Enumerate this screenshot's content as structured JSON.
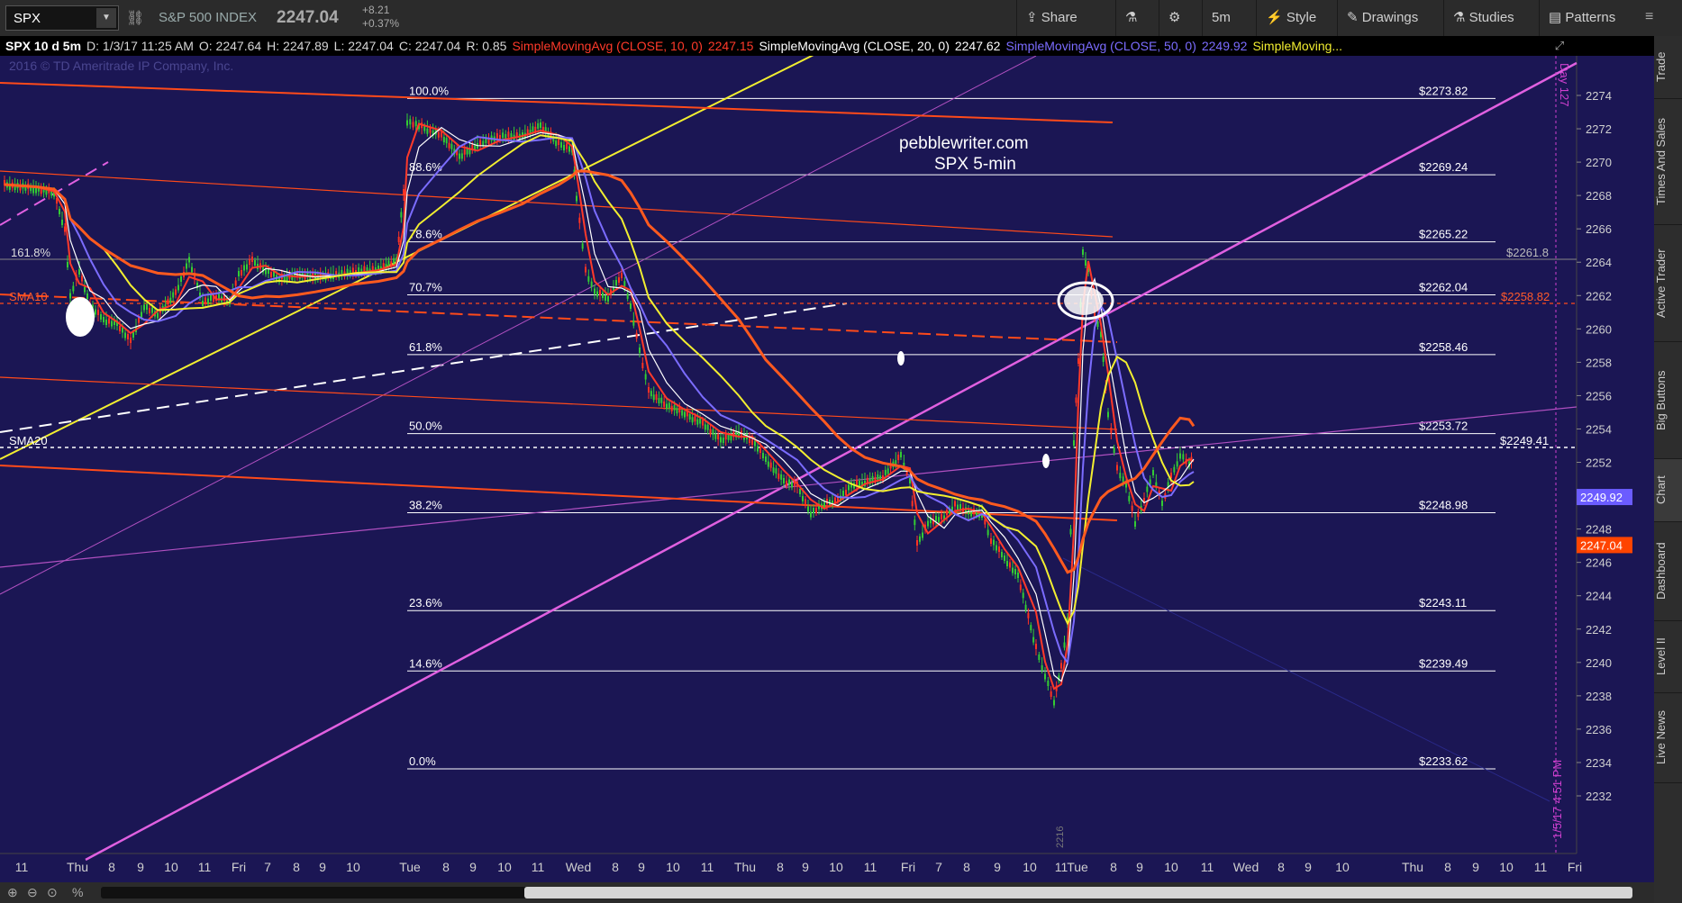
{
  "toolbar": {
    "symbol": "SPX",
    "index_name": "S&P 500 INDEX",
    "price": "2247.04",
    "change": "+8.21",
    "change_pct": "+0.37%",
    "share": "Share",
    "timeframe": "5m",
    "style": "Style",
    "drawings": "Drawings",
    "studies": "Studies",
    "patterns": "Patterns"
  },
  "header": {
    "title": "SPX 10 d 5m",
    "date": "D: 1/3/17 11:25 AM",
    "open": "O: 2247.64",
    "high": "H: 2247.89",
    "low": "L: 2247.04",
    "close": "C: 2247.04",
    "range": "R: 0.85",
    "sma10_label": "SimpleMovingAvg (CLOSE, 10, 0)",
    "sma10_val": "2247.15",
    "sma20_label": "SimpleMovingAvg (CLOSE, 20, 0)",
    "sma20_val": "2247.62",
    "sma50_label": "SimpleMovingAvg (CLOSE, 50, 0)",
    "sma50_val": "2249.92",
    "sma_more": "SimpleMoving..."
  },
  "watermark": "2016 © TD Ameritrade IP Company, Inc.",
  "annotation": {
    "line1": "pebblewriter.com",
    "line2": "SPX 5-min"
  },
  "right_tabs": [
    "Trade",
    "Times And Sales",
    "Active Trader",
    "Big Buttons",
    "Chart",
    "Dashboard",
    "Level II",
    "Live News"
  ],
  "chart_data": {
    "type": "candlestick",
    "y_axis": {
      "min": 2232,
      "max": 2274,
      "ticks": [
        2274,
        2272,
        2270,
        2268,
        2266,
        2264,
        2262,
        2260,
        2258,
        2256,
        2254,
        2252,
        2250,
        2248,
        2246,
        2244,
        2242,
        2240,
        2238,
        2236,
        2234,
        2232
      ]
    },
    "x_ticks": [
      "11",
      "Thu",
      "8",
      "9",
      "10",
      "11",
      "Fri",
      "7",
      "8",
      "9",
      "10",
      "Tue",
      "8",
      "9",
      "10",
      "11",
      "Wed",
      "8",
      "9",
      "10",
      "11",
      "Thu",
      "8",
      "9",
      "10",
      "11",
      "Fri",
      "7",
      "8",
      "9",
      "10",
      "11",
      "Tue",
      "8",
      "9",
      "10",
      "11",
      "Wed",
      "8",
      "9",
      "10",
      "Thu",
      "8",
      "9",
      "10",
      "11",
      "Fri"
    ],
    "fib_levels": [
      {
        "pct": "100.0%",
        "value": "$2273.82",
        "y": 2273.82
      },
      {
        "pct": "88.6%",
        "value": "$2269.24",
        "y": 2269.24
      },
      {
        "pct": "78.6%",
        "value": "$2265.22",
        "y": 2265.22
      },
      {
        "pct": "70.7%",
        "value": "$2262.04",
        "y": 2262.04
      },
      {
        "pct": "61.8%",
        "value": "$2258.46",
        "y": 2258.46
      },
      {
        "pct": "50.0%",
        "value": "$2253.72",
        "y": 2253.72
      },
      {
        "pct": "38.2%",
        "value": "$2248.98",
        "y": 2248.98
      },
      {
        "pct": "23.6%",
        "value": "$2243.11",
        "y": 2243.11
      },
      {
        "pct": "14.6%",
        "value": "$2239.49",
        "y": 2239.49
      },
      {
        "pct": "0.0%",
        "value": "$2233.62",
        "y": 2233.62
      }
    ],
    "labels": {
      "fib161": "161.8%",
      "level_2261": "$2261.8",
      "level_2258": "$2258.82",
      "level_2249": "$2249.41",
      "sma10": "SMA10",
      "sma20": "SMA20",
      "day127": "Day 127",
      "date_stamp": "1/5/17 4:51 PM",
      "tag_2216": "2216"
    },
    "price_tags": [
      {
        "value": "2249.92",
        "y": 2249.92,
        "color": "#6b5cff"
      },
      {
        "value": "2247.04",
        "y": 2247.04,
        "color": "#ff4400"
      }
    ],
    "series_colors": {
      "sma10": "#ff3a2a",
      "sma20": "#ffffff",
      "sma50": "#7b6cff",
      "sma_long": "#ff5a1f",
      "sma_yellow": "#f2ee30"
    }
  }
}
